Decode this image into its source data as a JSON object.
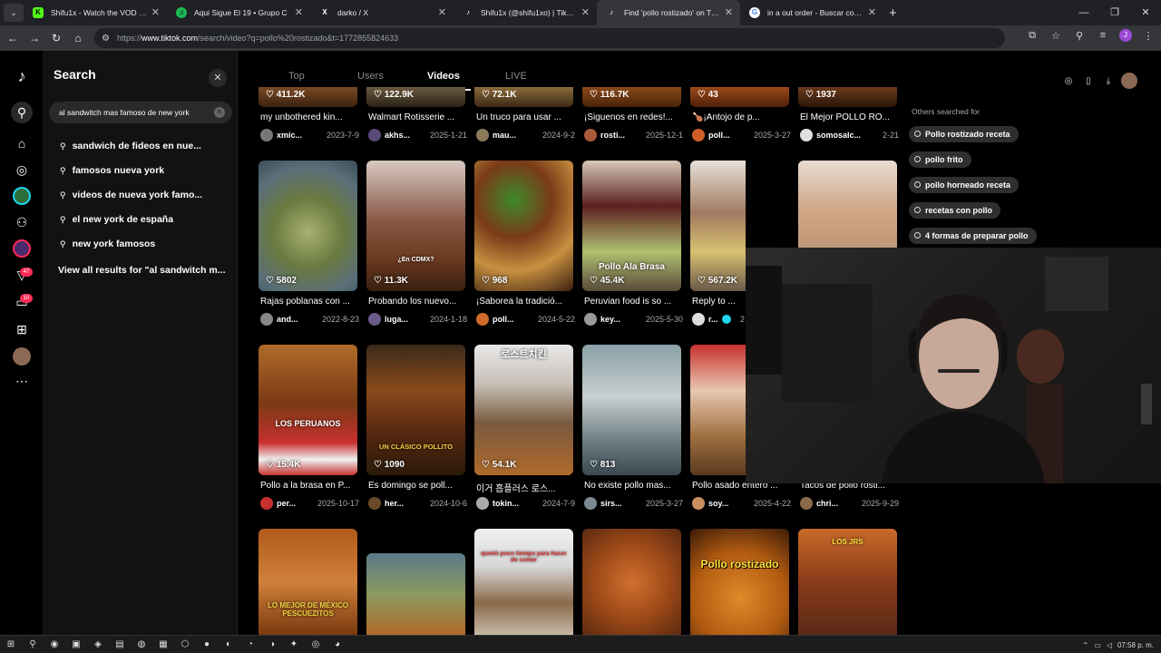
{
  "browser": {
    "tabs": [
      {
        "title": "Shifu1x - Watch the VOD on Ki",
        "favicon": "K"
      },
      {
        "title": "Aqui Sigue El 19 • Grupo C",
        "favicon": "♫"
      },
      {
        "title": "darko / X",
        "favicon": "X"
      },
      {
        "title": "Shifu1x (@shifu1xo) | TikTok",
        "favicon": "♪"
      },
      {
        "title": "Find 'pollo rostizado' on TikTok",
        "favicon": "♪"
      },
      {
        "title": "in a out order - Buscar con Go",
        "favicon": "G"
      }
    ],
    "url_prefix": "https://",
    "url_domain": "www.tiktok.com",
    "url_path": "/search/video?q=pollo%20rostizado&t=1772855824633",
    "profile_initial": "J"
  },
  "rail": {
    "badge_inbox": "47",
    "badge_messages": "10"
  },
  "search": {
    "title": "Search",
    "query": "al sandwitch mas famoso de new york",
    "suggestions": [
      "sandwich de fideos en nue...",
      "famosos nueva york",
      "videos de nueva york famo...",
      "el new york de españa",
      "new york famosos"
    ],
    "view_all": "View all results for \"al sandwitch m..."
  },
  "main": {
    "tabs": [
      "Top",
      "Users",
      "Videos",
      "LIVE"
    ],
    "active_tab": "Videos",
    "top_row": [
      {
        "views": "411.2K",
        "caption": "my unbothered kin...",
        "user": "xmic...",
        "date": "2023-7-9"
      },
      {
        "views": "122.9K",
        "caption": "Walmart Rotisserie ...",
        "user": "akhs...",
        "date": "2025-1-21"
      },
      {
        "views": "72.1K",
        "caption": "Un truco para usar ...",
        "user": "mau...",
        "date": "2024-9-2"
      },
      {
        "views": "116.7K",
        "caption": "¡Siguenos en redes!...",
        "user": "rosti...",
        "date": "2025-12-1"
      },
      {
        "views": "43",
        "caption": "🍗¡Antojo de p...",
        "user": "poll...",
        "date": "2025-3-27"
      },
      {
        "views": "1937",
        "caption": "El Mejor POLLO RO...",
        "user": "somosalc...",
        "date": "2-21"
      }
    ],
    "row2": [
      {
        "views": "5802",
        "caption": "Rajas poblanas con ...",
        "user": "and...",
        "date": "2022-8-23",
        "overlay": ""
      },
      {
        "views": "11.3K",
        "caption": "Probando los nuevo...",
        "user": "luga...",
        "date": "2024-1-18",
        "overlay": "¿En CDMX?"
      },
      {
        "views": "968",
        "caption": "¡Saborea la tradició...",
        "user": "poll...",
        "date": "2024-5-22",
        "overlay": ""
      },
      {
        "views": "45.4K",
        "caption": "Peruvian food is so ...",
        "user": "key...",
        "date": "2025-5-30",
        "overlay": "Pollo Ala Brasa"
      },
      {
        "views": "567.2K",
        "caption": "Reply to ...",
        "user": "r...",
        "date": "2",
        "overlay": ""
      },
      {
        "views": "",
        "caption": "",
        "user": "",
        "date": "",
        "overlay": ""
      }
    ],
    "row3": [
      {
        "views": "15.4K",
        "caption": "Pollo a la brasa en P...",
        "user": "per...",
        "date": "2025-10-17",
        "overlay": "LOS PERUANOS"
      },
      {
        "views": "1090",
        "caption": "Es domingo se poll...",
        "user": "her...",
        "date": "2024-10-6",
        "overlay": "UN CLÁSICO POLLITO"
      },
      {
        "views": "54.1K",
        "caption": "이거 흡플러스 로스...",
        "user": "tokin...",
        "date": "2024-7-9",
        "overlay": "로스트치킨"
      },
      {
        "views": "813",
        "caption": "No existe pollo mas...",
        "user": "sirs...",
        "date": "2025-3-27",
        "overlay": ""
      },
      {
        "views": "",
        "caption": "Pollo asado entero ...",
        "user": "soy...",
        "date": "2025-4-22",
        "overlay": ""
      },
      {
        "views": "",
        "caption": "Tacos de pollo rosti...",
        "user": "chri...",
        "date": "2025-9-29",
        "overlay": ""
      }
    ],
    "row4": [
      {
        "overlay": "LO MEJOR DE MÉXICO PESCUEZITOS"
      },
      {
        "overlay": ""
      },
      {
        "overlay": "quedó poco tiempo para hacer de comer"
      },
      {
        "overlay": ""
      },
      {
        "overlay": "Pollo rostizado"
      },
      {
        "overlay": "LOS JRS"
      }
    ],
    "others_title": "Others searched for",
    "others": [
      "Pollo rostizado receta",
      "pollo frito",
      "pollo horneado receta",
      "recetas con pollo",
      "4 formas de preparar pollo"
    ]
  },
  "taskbar": {
    "time": "07:58 p. m."
  },
  "colors": {
    "accent": "#fe2c55",
    "panel": "#121212"
  }
}
